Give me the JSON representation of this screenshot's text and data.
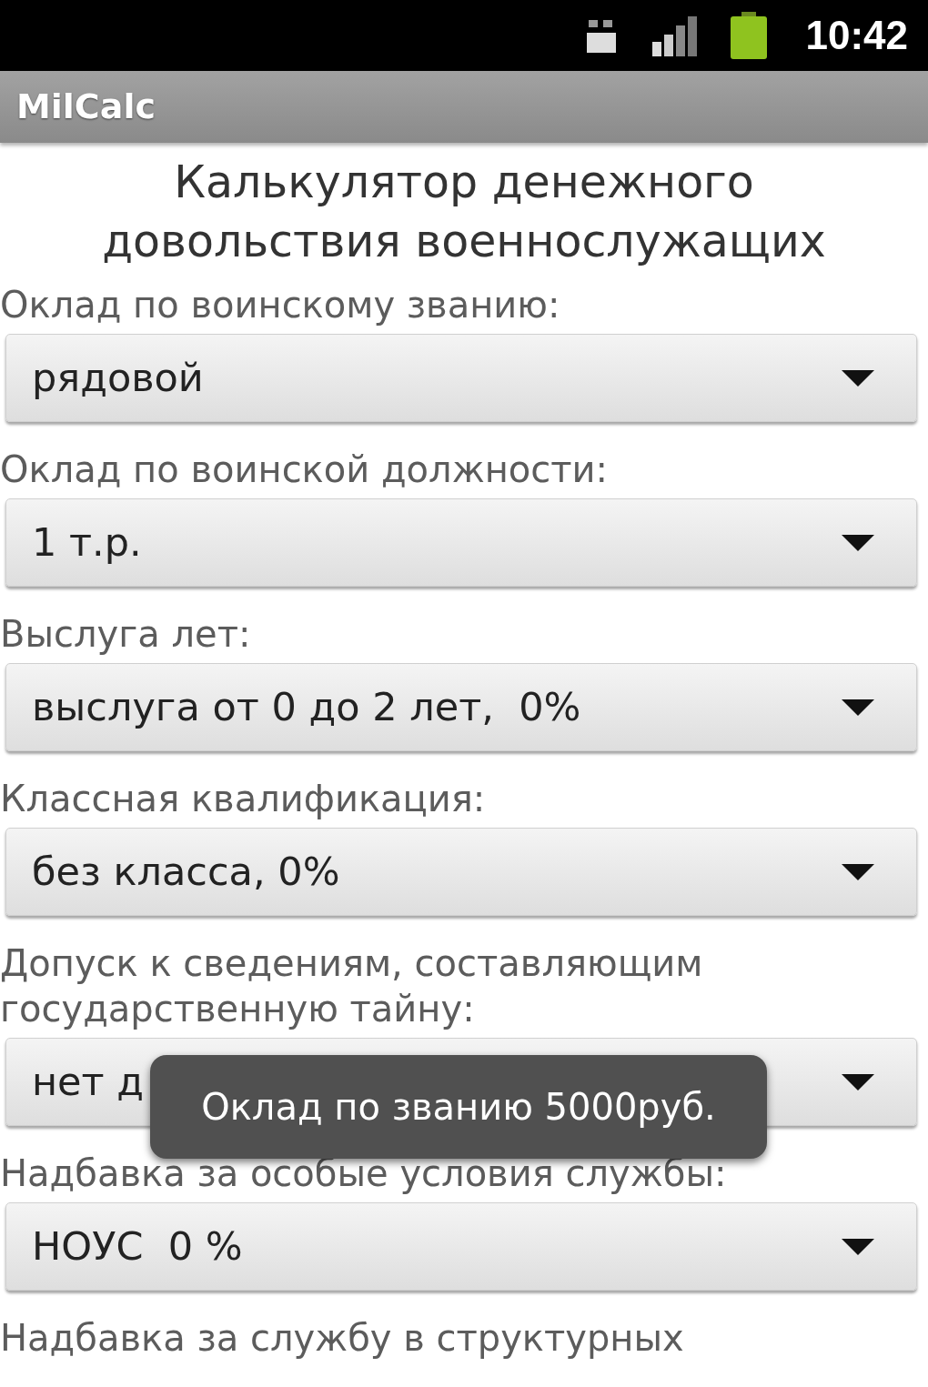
{
  "status_bar": {
    "time": "10:42"
  },
  "action_bar": {
    "title": "MilCalc"
  },
  "heading": "Калькулятор денежного довольствия военнослужащих",
  "fields": [
    {
      "label": "Оклад по воинскому званию:",
      "value": "рядовой"
    },
    {
      "label": "Оклад по воинской должности:",
      "value": "1 т.р."
    },
    {
      "label": "Выслуга лет:",
      "value": "выслуга от 0 до 2 лет,  0%"
    },
    {
      "label": "Классная квалификация:",
      "value": "без класса, 0%"
    },
    {
      "label": "Допуск к сведениям, составляющим государственную тайну:",
      "value": "нет д"
    },
    {
      "label": "Надбавка за особые условия службы:",
      "value": "НОУС  0 %"
    }
  ],
  "next_label": "Надбавка за службу в структурных",
  "toast": {
    "text": "Оклад по званию 5000руб."
  }
}
